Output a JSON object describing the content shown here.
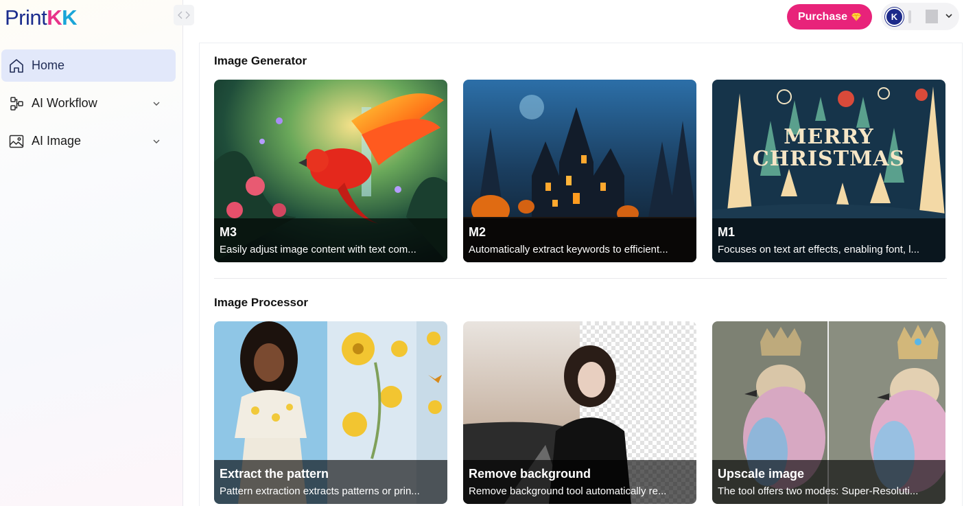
{
  "app": {
    "logo_text": "Print",
    "logo_k1": "K",
    "logo_k2": "K"
  },
  "sidebar": {
    "items": [
      {
        "label": "Home",
        "icon": "home-icon",
        "active": true
      },
      {
        "label": "AI Workflow",
        "icon": "workflow-icon",
        "expandable": true
      },
      {
        "label": "AI Image",
        "icon": "image-icon",
        "expandable": true
      }
    ]
  },
  "header": {
    "purchase_label": "Purchase",
    "avatar_initial": "K"
  },
  "sections": [
    {
      "title": "Image Generator",
      "cards": [
        {
          "title": "M3",
          "description": "Easily adjust image content with text com...",
          "art": "parrot-forest-illustration"
        },
        {
          "title": "M2",
          "description": "Automatically extract keywords to efficient...",
          "art": "halloween-castle-illustration"
        },
        {
          "title": "M1",
          "description": "Focuses on text art effects, enabling font, l...",
          "art": "merry-christmas-text-art",
          "art_text": "MERRY CHRISTMAS"
        }
      ]
    },
    {
      "title": "Image Processor",
      "cards": [
        {
          "title": "Extract the pattern",
          "description": "Pattern extraction extracts patterns or prin...",
          "art": "woman-floral-top-pattern"
        },
        {
          "title": "Remove background",
          "description": "Remove background tool automatically re...",
          "art": "woman-transparent-background"
        },
        {
          "title": "Upscale image",
          "description": "The tool offers two modes: Super-Resoluti...",
          "art": "bird-with-crown-comparison"
        }
      ]
    }
  ],
  "colors": {
    "brand_blue": "#1b2d8e",
    "brand_pink": "#e8237a",
    "active_nav_bg": "#e2e8fa"
  }
}
